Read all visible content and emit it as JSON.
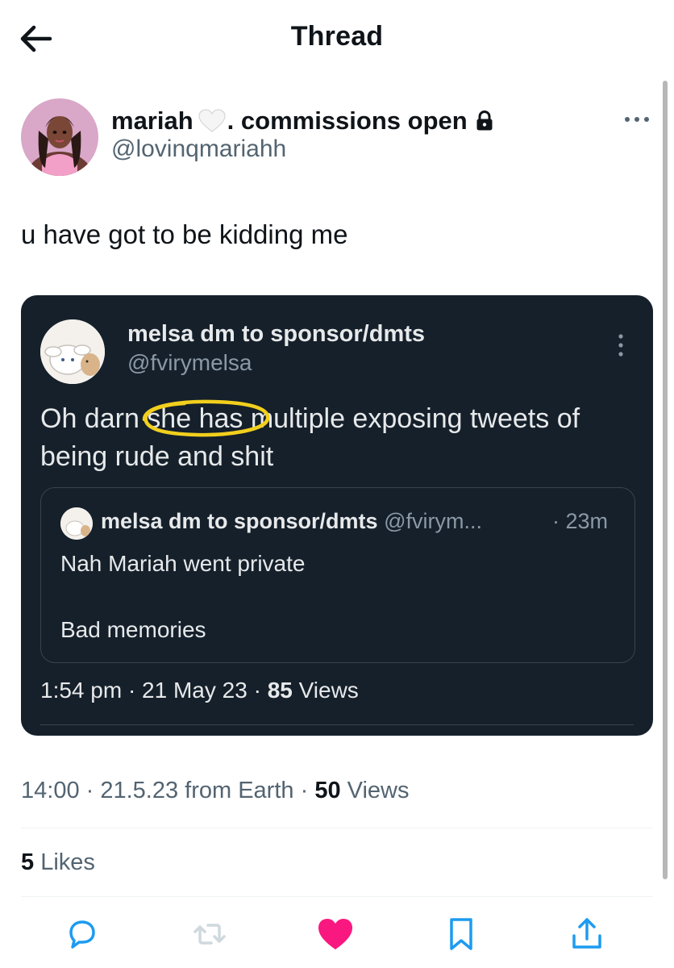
{
  "header": {
    "title": "Thread"
  },
  "author": {
    "name": "mariah",
    "name_suffix": ". commissions open",
    "handle": "@lovinqmariahh"
  },
  "tweet": {
    "text": "u have got to be kidding me"
  },
  "screenshot": {
    "name": "melsa dm to sponsor/dmts",
    "handle": "@fvirymelsa",
    "text": "Oh darn she has multiple exposing tweets of being rude and shit",
    "quoted": {
      "name": "melsa dm to sponsor/dmts",
      "handle": "@fvirym...",
      "time": "· 23m",
      "line1": "Nah Mariah went private",
      "line2": "Bad memories"
    },
    "meta": {
      "datetime": "1:54 pm · 21 May 23 · ",
      "views_count": "85",
      "views_label": " Views"
    }
  },
  "meta": {
    "datetime": "14:00 · 21.5.23 from Earth · ",
    "views_count": "50",
    "views_label": " Views"
  },
  "likes": {
    "count": "5",
    "label": " Likes"
  },
  "colors": {
    "like_pink": "#f91880",
    "icon_blue": "#1d9bf0",
    "retweet_gray": "#cfd9de",
    "card_bg": "#15202b"
  },
  "icons": [
    "back-arrow-icon",
    "white-heart-emoji-icon",
    "lock-icon",
    "more-dots-icon",
    "reply-icon",
    "retweet-icon",
    "like-heart-icon",
    "bookmark-icon",
    "share-icon"
  ]
}
